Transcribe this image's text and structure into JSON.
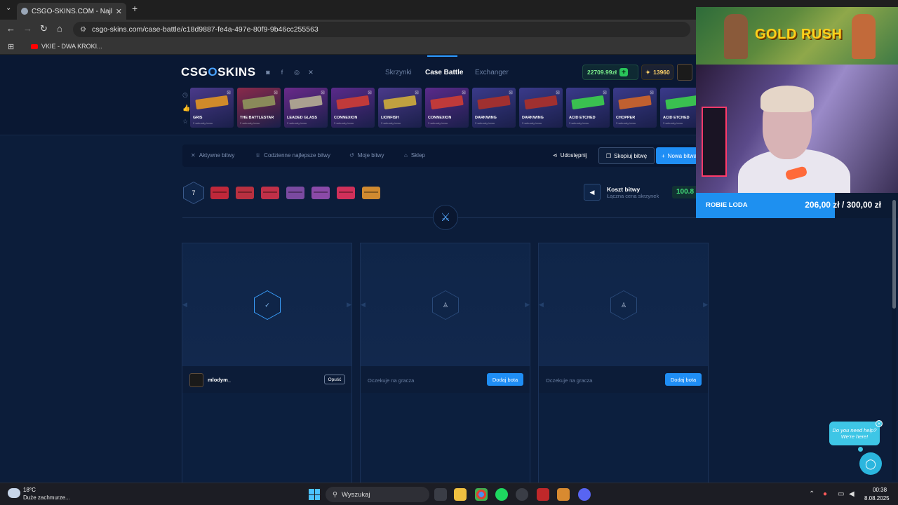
{
  "browser": {
    "tab_title": "CSGO-SKINS.COM - Najlepsze",
    "tab_close": "✕",
    "new_tab": "+",
    "url": "csgo-skins.com/case-battle/c18d9887-fe4a-497e-80f9-9b46cc255563",
    "bookmark": "VKIE - DWA KROKI..."
  },
  "site": {
    "logo_left": "CSG",
    "logo_o": "O",
    "logo_right": "SKINS",
    "nav": [
      "Skrzynki",
      "Case Battle",
      "Exchanger"
    ],
    "balance": "22709.99zł",
    "coins": "13960",
    "accent": "#1f8ef5"
  },
  "drops": [
    {
      "name": "GRIS",
      "sub": "2 sekundy temu",
      "bg": "#4a3a8a",
      "gun": "#d08a2a"
    },
    {
      "name": "THE BATTLESTAR",
      "sub": "2 sekundy temu",
      "bg": "#8a2a4a",
      "gun": "#8a8a5a"
    },
    {
      "name": "LEADED GLASS",
      "sub": "2 sekundy temu",
      "bg": "#6a2a8a",
      "gun": "#aaa090"
    },
    {
      "name": "CONNEXION",
      "sub": "3 sekundy temu",
      "bg": "#5a2a8a",
      "gun": "#c03a3a"
    },
    {
      "name": "LIONFISH",
      "sub": "3 sekundy temu",
      "bg": "#4a3a8a",
      "gun": "#c0a040"
    },
    {
      "name": "CONNEXION",
      "sub": "3 sekundy temu",
      "bg": "#5a2a8a",
      "gun": "#c03a3a"
    },
    {
      "name": "DARKWING",
      "sub": "3 sekundy temu",
      "bg": "#3a3a8a",
      "gun": "#a03030"
    },
    {
      "name": "DARKWING",
      "sub": "3 sekundy temu",
      "bg": "#3a3a8a",
      "gun": "#a03030"
    },
    {
      "name": "ACID ETCHED",
      "sub": "3 sekundy temu",
      "bg": "#3a3a8a",
      "gun": "#3ac050"
    },
    {
      "name": "CHOPPER",
      "sub": "3 sekundy temu",
      "bg": "#3a3a8a",
      "gun": "#c06030"
    },
    {
      "name": "ACID ETCHED",
      "sub": "3 sekundy temu",
      "bg": "#3a3a8a",
      "gun": "#3ac050"
    }
  ],
  "battle_menu": {
    "active": "Aktywne bitwy",
    "daily": "Codzienne najlepsze bitwy",
    "mine": "Moje bitwy",
    "shop": "Sklep",
    "share": "Udostępnij",
    "copy": "Skopiuj bitwę",
    "new": "Nowa bitwa"
  },
  "battle": {
    "rounds": "7",
    "cases": [
      "#c0283a",
      "#b83040",
      "#c03048",
      "#7a4aa0",
      "#8a4aa8",
      "#d0305a",
      "#d08a30"
    ],
    "cost_title": "Koszt bitwy",
    "cost_sub": "Łączna cena skrzynek",
    "cost_value": "100.8"
  },
  "slots": [
    {
      "player": "mlodym_",
      "leave": "Opuść",
      "ready": true
    },
    {
      "waiting": "Oczekuje na gracza",
      "bot": "Dodaj bota"
    },
    {
      "waiting": "Oczekuje na gracza",
      "bot": "Dodaj bota"
    }
  ],
  "overlay": {
    "game_title": "GOLD RUSH",
    "goal_label": "ROBIE LODA",
    "goal_value": "206,00 zł / 300,00 zł",
    "goal_progress": 0.6867
  },
  "help": {
    "line1": "Do you need help?",
    "line2": "We're here!"
  },
  "taskbar": {
    "temp": "18°C",
    "weather": "Duże zachmurze...",
    "search": "Wyszukaj",
    "time": "00:38",
    "date": "8.08.2025"
  }
}
